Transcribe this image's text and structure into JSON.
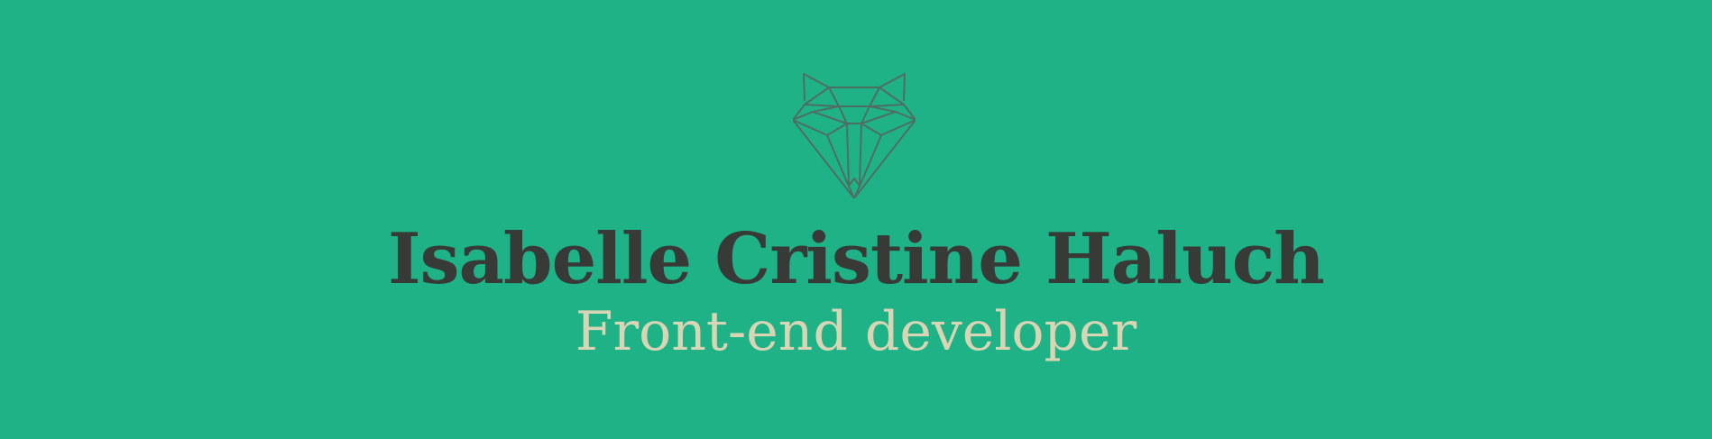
{
  "colors": {
    "background": "#1fb287",
    "logo_stroke": "#4f6e63",
    "name_text": "#383a38",
    "role_text": "#d8d5b5"
  },
  "hero": {
    "logo_icon": "geometric-fox-head-icon",
    "name": "Isabelle Cristine Haluch",
    "role": "Front-end developer"
  }
}
